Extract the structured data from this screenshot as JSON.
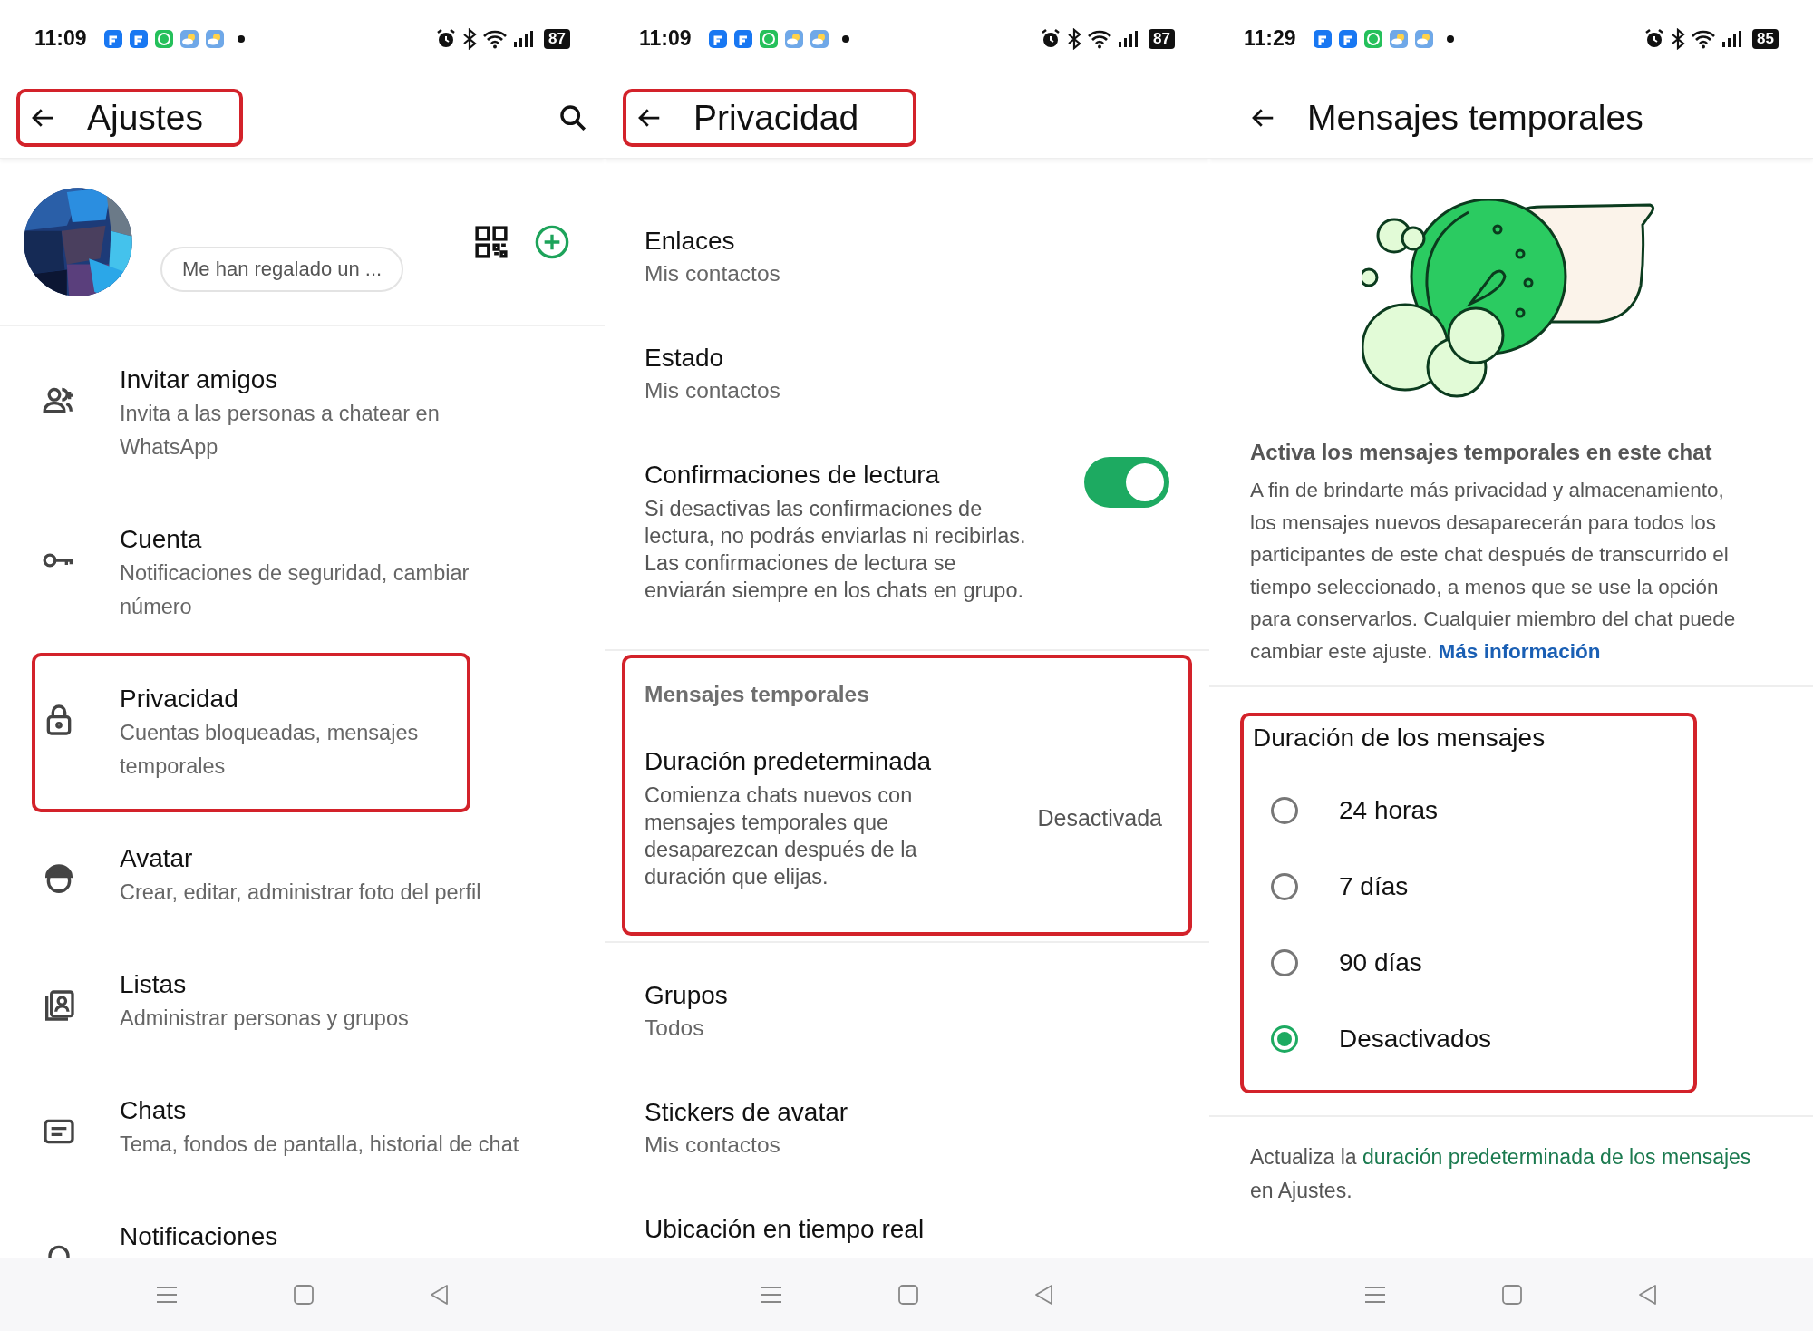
{
  "panels": [
    {
      "kind": "settings",
      "status_bar": {
        "time": "11:09",
        "battery": "87"
      },
      "header": {
        "title": "Ajustes",
        "highlighted": true
      },
      "profile": {
        "status": "Me han regalado un ..."
      },
      "items": [
        {
          "title": "Invitar amigos",
          "subtitle": "Invita a las personas a chatear en WhatsApp",
          "highlighted": false
        },
        {
          "title": "Cuenta",
          "subtitle": "Notificaciones de seguridad, cambiar número",
          "highlighted": false
        },
        {
          "title": "Privacidad",
          "subtitle": "Cuentas bloqueadas, mensajes temporales",
          "highlighted": true
        },
        {
          "title": "Avatar",
          "subtitle": "Crear, editar, administrar foto del perfil",
          "highlighted": false
        },
        {
          "title": "Listas",
          "subtitle": "Administrar personas y grupos",
          "highlighted": false
        },
        {
          "title": "Chats",
          "subtitle": "Tema, fondos de pantalla, historial de chat",
          "highlighted": false
        },
        {
          "title": "Notificaciones",
          "highlighted": false
        }
      ]
    },
    {
      "kind": "privacy",
      "status_bar": {
        "time": "11:09",
        "battery": "87"
      },
      "header": {
        "title": "Privacidad",
        "highlighted": true
      },
      "items": [
        {
          "kind": "plain",
          "title": "Enlaces",
          "subtitle": "Mis contactos"
        },
        {
          "kind": "plain",
          "title": "Estado",
          "subtitle": "Mis contactos"
        },
        {
          "kind": "toggle",
          "title": "Confirmaciones de lectura",
          "subtitle": "Si desactivas las confirmaciones de lectura, no podrás enviarlas ni recibirlas. Las confirmaciones de lectura se enviarán siempre en los chats en grupo.",
          "on": true
        },
        {
          "kind": "section",
          "heading": "Mensajes temporales",
          "title": "Duración predeterminada",
          "subtitle": "Comienza chats nuevos con mensajes temporales que desaparezcan después de la duración que elijas.",
          "value": "Desactivada",
          "highlighted": true
        },
        {
          "kind": "plain",
          "title": "Grupos",
          "subtitle": "Todos"
        },
        {
          "kind": "plain",
          "title": "Stickers de avatar",
          "subtitle": "Mis contactos"
        },
        {
          "kind": "plain",
          "title": "Ubicación en tiempo real"
        }
      ]
    },
    {
      "kind": "disappearing",
      "status_bar": {
        "time": "11:29",
        "battery": "85"
      },
      "header": {
        "title": "Mensajes temporales",
        "highlighted": false
      },
      "heading": "Activa los mensajes temporales en este chat",
      "description": "A fin de brindarte más privacidad y almacenamiento, los mensajes nuevos desaparecerán para todos los participantes de este chat después de transcurrido el tiempo seleccionado, a menos que se use la opción para conservarlos. Cualquier miembro del chat puede cambiar este ajuste.",
      "more_link": "Más información",
      "duration": {
        "title": "Duración de los mensajes",
        "highlighted": true,
        "options": [
          {
            "label": "24 horas",
            "selected": false
          },
          {
            "label": "7 días",
            "selected": false
          },
          {
            "label": "90 días",
            "selected": false
          },
          {
            "label": "Desactivados",
            "selected": true
          }
        ]
      },
      "footer": {
        "before": "Actualiza la",
        "link": "duración predeterminada de los mensajes",
        "after": "en Ajustes."
      }
    }
  ]
}
